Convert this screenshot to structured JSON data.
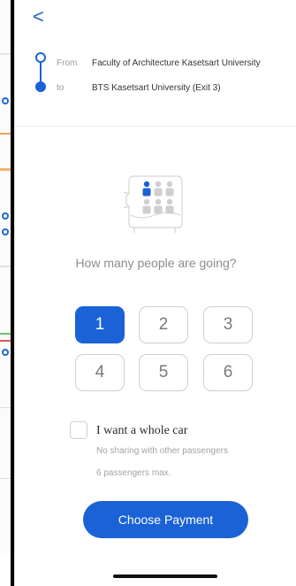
{
  "header": {
    "back_glyph": "<"
  },
  "route": {
    "from_label": "From",
    "from_value": "Faculty of Architecture Kasetsart University",
    "to_label": "to",
    "to_value": "BTS Kasetsart University (Exit 3)"
  },
  "passengers": {
    "question": "How many people are going?",
    "options": [
      "1",
      "2",
      "3",
      "4",
      "5",
      "6"
    ],
    "selected": "1"
  },
  "whole_car": {
    "title": "I want a whole car",
    "subtitle1": "No sharing with other passengers",
    "subtitle2": "6 passengers max.",
    "checked": false
  },
  "actions": {
    "choose_payment": "Choose Payment"
  },
  "colors": {
    "accent": "#1a62d6",
    "muted": "#8c8c8c",
    "border": "#cfcfcf"
  },
  "icons": [
    "back-chevron-icon",
    "route-origin-icon",
    "route-destination-icon",
    "shared-car-seats-icon"
  ]
}
